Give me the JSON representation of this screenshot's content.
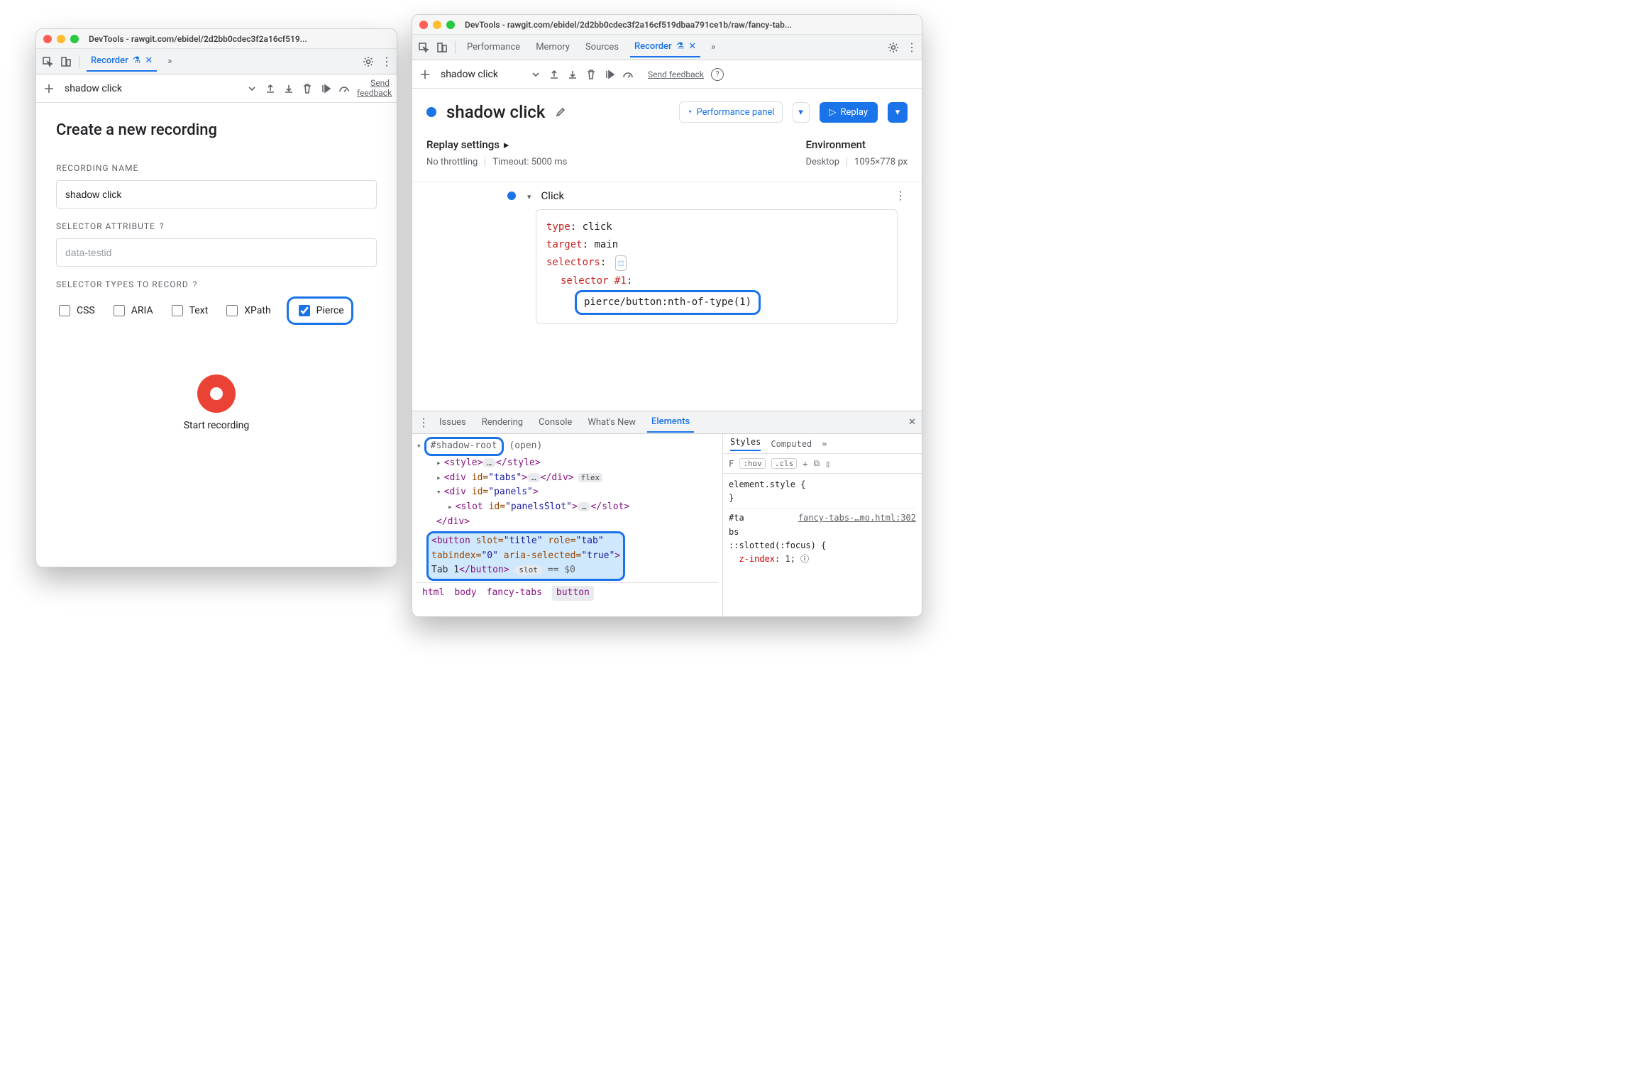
{
  "window_left": {
    "title": "DevTools - rawgit.com/ebidel/2d2bb0cdec3f2a16cf519...",
    "tab": "Recorder",
    "toolbar": {
      "recording_name": "shadow click",
      "send_feedback": "Send feedback"
    },
    "form": {
      "heading": "Create a new recording",
      "label_name": "RECORDING NAME",
      "name_value": "shadow click",
      "label_selector_attr": "SELECTOR ATTRIBUTE",
      "selector_attr_placeholder": "data-testid",
      "label_selector_types": "SELECTOR TYPES TO RECORD",
      "types": {
        "css": "CSS",
        "aria": "ARIA",
        "text": "Text",
        "xpath": "XPath",
        "pierce": "Pierce"
      },
      "start_label": "Start recording"
    }
  },
  "window_right": {
    "title": "DevTools - rawgit.com/ebidel/2d2bb0cdec3f2a16cf519dbaa791ce1b/raw/fancy-tab...",
    "tabs": {
      "perf": "Performance",
      "mem": "Memory",
      "src": "Sources",
      "rec": "Recorder"
    },
    "toolbar": {
      "recording_name": "shadow click",
      "send_feedback": "Send feedback"
    },
    "header": {
      "title": "shadow click",
      "perf_button": "Performance panel",
      "replay_button": "Replay"
    },
    "settings": {
      "replay_label": "Replay settings",
      "throttling": "No throttling",
      "timeout": "Timeout: 5000 ms",
      "env_label": "Environment",
      "device": "Desktop",
      "viewport": "1095×778 px"
    },
    "step": {
      "name": "Click",
      "type_k": "type",
      "type_v": "click",
      "target_k": "target",
      "target_v": "main",
      "selectors_k": "selectors",
      "sel_index": "selector #1",
      "sel_value": "pierce/button:nth-of-type(1)"
    },
    "drawer": {
      "tabs": {
        "issues": "Issues",
        "rendering": "Rendering",
        "console": "Console",
        "whatsnew": "What's New",
        "elements": "Elements"
      },
      "dom": {
        "shadow_root": "#shadow-root",
        "shadow_mode": "(open)",
        "style_tag": "<style>",
        "style_close": "</style>",
        "tabs_div": "<div id=\"tabs\">",
        "div_close": "</div>",
        "flex": "flex",
        "panels_div": "<div id=\"panels\">",
        "slot": "<slot id=\"panelsSlot\">",
        "slot_close": "</slot>",
        "button_line1": "<button slot=\"title\" role=\"tab\"",
        "button_line2": "tabindex=\"0\" aria-selected=\"true\">",
        "button_text": "Tab 1",
        "button_close": "</button>",
        "slot_chip": "slot",
        "eqvar": "== $0"
      },
      "crumbs": {
        "html": "html",
        "body": "body",
        "fancy": "fancy-tabs",
        "button": "button"
      },
      "styles": {
        "tab_styles": "Styles",
        "tab_computed": "Computed",
        "filter": "F",
        "hov": ":hov",
        "cls": ".cls",
        "rule1": "element.style {",
        "rule1_close": "}",
        "rule2_sel": "#ta\nbs",
        "rule2_src": "fancy-tabs-…mo.html:302",
        "rule3_sel": "::slotted(:focus) {",
        "rule3_prop": "z-index",
        "rule3_val": "1;"
      }
    }
  }
}
